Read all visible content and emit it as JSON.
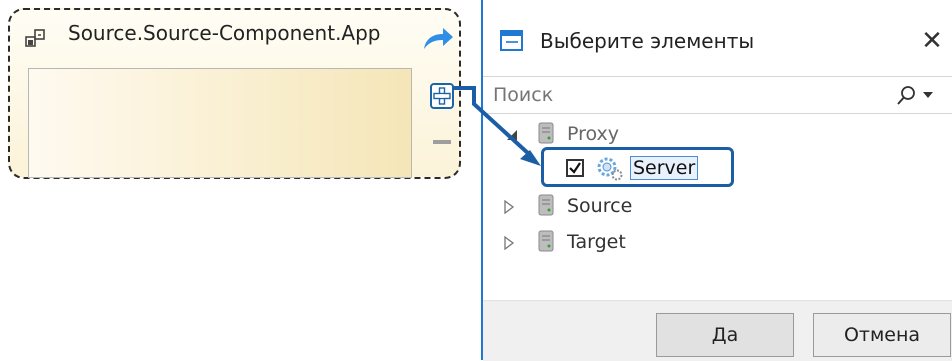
{
  "component": {
    "title": "Source.Source-Component.App",
    "icons": {
      "component": "component-icon",
      "share": "share-arrow-icon",
      "add": "plus-icon",
      "remove": "minus-icon"
    }
  },
  "dialog": {
    "title": "Выберите элементы",
    "close_label": "✕",
    "search": {
      "placeholder": "Поиск",
      "value": ""
    },
    "tree": [
      {
        "label": "Proxy",
        "expanded": true,
        "children": [
          {
            "label": "Server",
            "checked": true
          }
        ]
      },
      {
        "label": "Source",
        "expanded": false
      },
      {
        "label": "Target",
        "expanded": false
      }
    ],
    "buttons": {
      "ok": "Да",
      "cancel": "Отмена"
    }
  },
  "colors": {
    "accent": "#1c5ea5",
    "card_border": "#2b2b2b",
    "dialog_border": "#1f78d1"
  }
}
